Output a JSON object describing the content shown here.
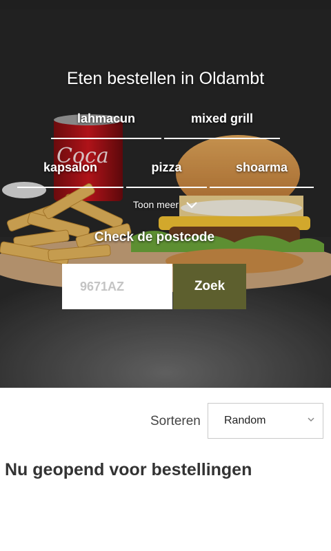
{
  "hero": {
    "title": "Eten bestellen in Oldambt",
    "categories": [
      "lahmacun",
      "mixed grill",
      "kapsalon",
      "pizza",
      "shoarma"
    ],
    "toon_meer": "Toon meer"
  },
  "postcode": {
    "title": "Check de postcode",
    "placeholder": "9671AZ",
    "button_label": "Zoek"
  },
  "sort": {
    "label": "Sorteren",
    "selected": "Random"
  },
  "main": {
    "heading": "Nu geopend voor bestellingen"
  },
  "colors": {
    "accent": "#5d5f2e"
  }
}
